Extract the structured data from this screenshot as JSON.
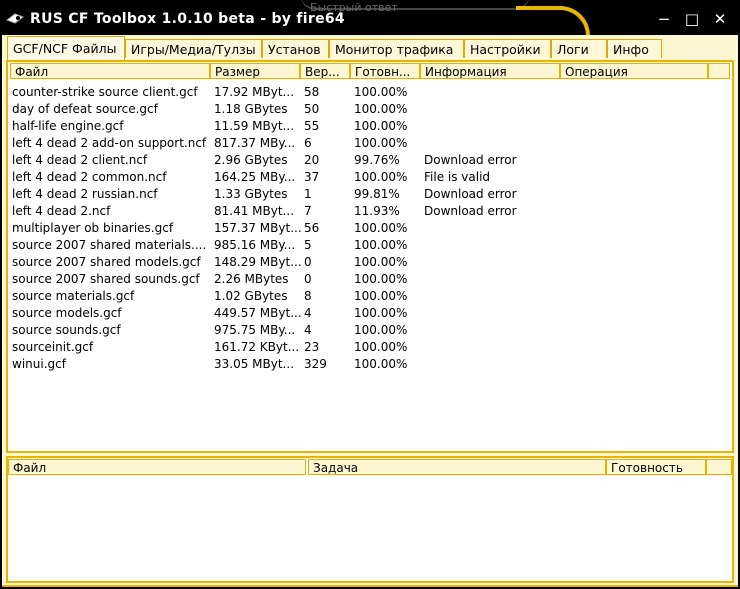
{
  "window": {
    "title": "RUS CF Toolbox 1.0.10 beta - by fire64",
    "background_caption": "Быстрый ответ",
    "controls": {
      "minimize": "−",
      "maximize": "□",
      "close": "✕"
    }
  },
  "tabs": [
    {
      "label": "GCF/NCF Файлы",
      "active": true
    },
    {
      "label": "Игры/Медиа/Тулзы"
    },
    {
      "label": "Установ"
    },
    {
      "label": "Монитор трафика"
    },
    {
      "label": "Настройки"
    },
    {
      "label": "Логи"
    },
    {
      "label": "Инфо"
    }
  ],
  "files_table": {
    "columns": [
      "Файл",
      "Размер",
      "Вер...",
      "Готовн...",
      "Информация",
      "Операция"
    ],
    "rows": [
      [
        "counter-strike source client.gcf",
        "17.92 MByt...",
        "58",
        "100.00%",
        "",
        ""
      ],
      [
        "day of defeat source.gcf",
        "1.18 GBytes",
        "50",
        "100.00%",
        "",
        ""
      ],
      [
        "half-life engine.gcf",
        "11.59 MByt...",
        "55",
        "100.00%",
        "",
        ""
      ],
      [
        "left 4 dead 2 add-on support.ncf",
        "817.37 MBy...",
        "6",
        "100.00%",
        "",
        ""
      ],
      [
        "left 4 dead 2 client.ncf",
        "2.96 GBytes",
        "20",
        "99.76%",
        "Download error",
        ""
      ],
      [
        "left 4 dead 2 common.ncf",
        "164.25 MBy...",
        "37",
        "100.00%",
        "File is valid",
        ""
      ],
      [
        "left 4 dead 2 russian.ncf",
        "1.33 GBytes",
        "1",
        "99.81%",
        "Download error",
        ""
      ],
      [
        "left 4 dead 2.ncf",
        "81.41 MByt...",
        "7",
        "11.93%",
        "Download error",
        ""
      ],
      [
        "multiplayer ob binaries.gcf",
        "157.37 MByt...",
        "56",
        "100.00%",
        "",
        ""
      ],
      [
        "source 2007 shared materials....",
        "985.16 MBy...",
        "5",
        "100.00%",
        "",
        ""
      ],
      [
        "source 2007 shared models.gcf",
        "148.29 MByt...",
        "0",
        "100.00%",
        "",
        ""
      ],
      [
        "source 2007 shared sounds.gcf",
        "2.26 MBytes",
        "0",
        "100.00%",
        "",
        ""
      ],
      [
        "source materials.gcf",
        "1.02 GBytes",
        "8",
        "100.00%",
        "",
        ""
      ],
      [
        "source models.gcf",
        "449.57 MByt...",
        "4",
        "100.00%",
        "",
        ""
      ],
      [
        "source sounds.gcf",
        "975.75 MBy...",
        "4",
        "100.00%",
        "",
        ""
      ],
      [
        "sourceinit.gcf",
        "161.72 KByt...",
        "23",
        "100.00%",
        "",
        ""
      ],
      [
        "winui.gcf",
        "33.05 MByt...",
        "329",
        "100.00%",
        "",
        ""
      ]
    ]
  },
  "tasks_table": {
    "columns": [
      "Файл",
      "Задача",
      "Готовность"
    ],
    "rows": []
  },
  "colors": {
    "accent": "#e8b400",
    "panel_bg": "#fff7d2",
    "titlebar": "#000000"
  }
}
